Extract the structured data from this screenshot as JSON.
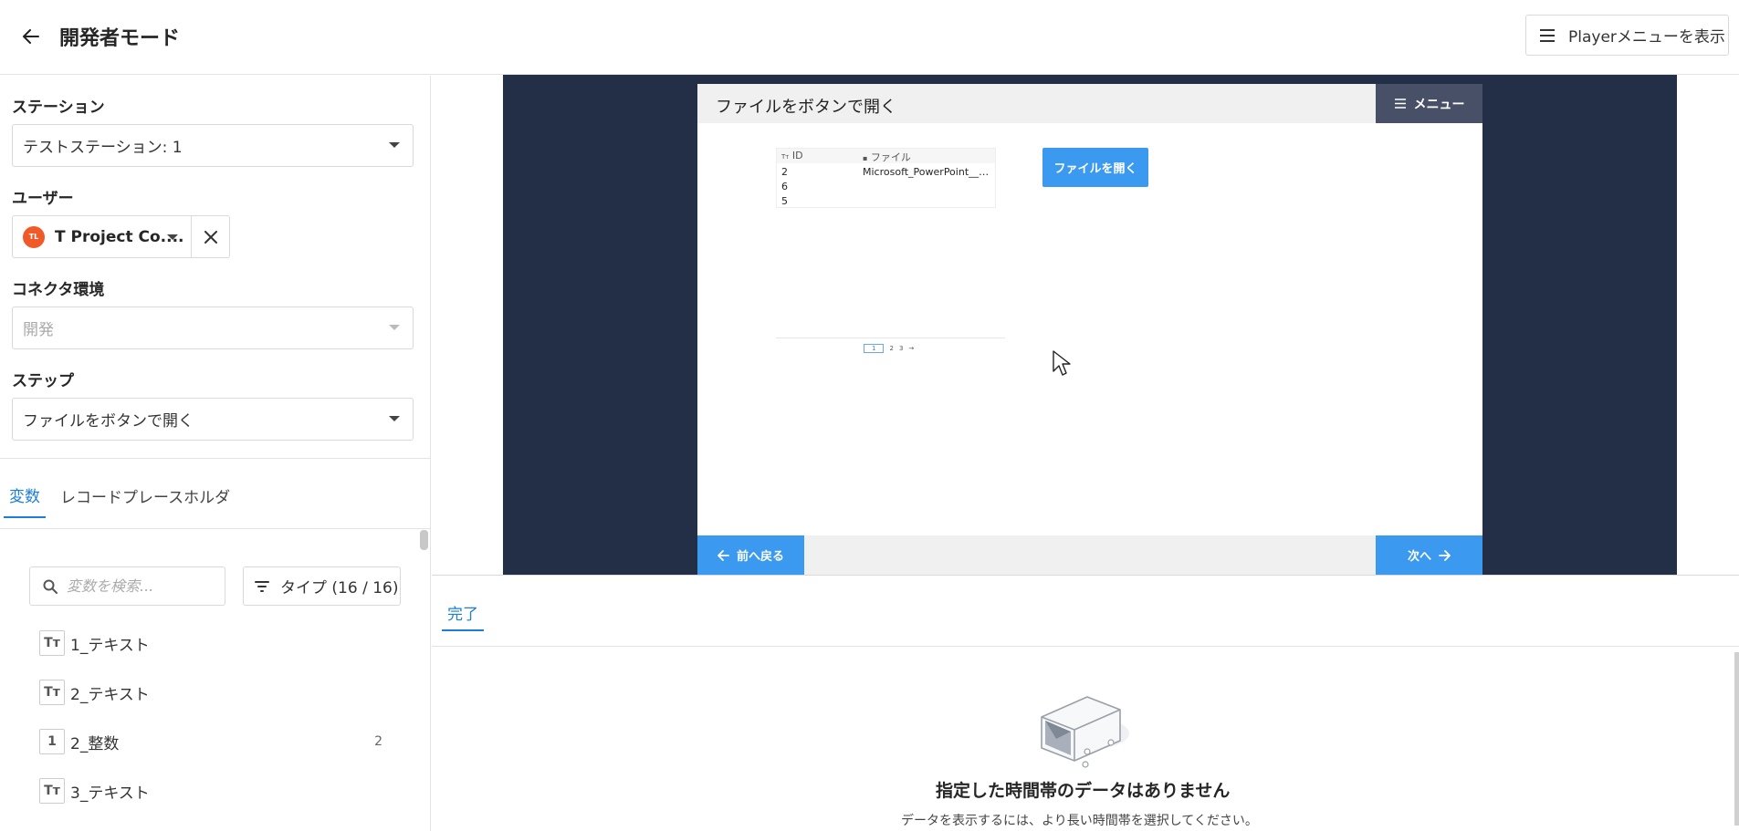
{
  "header": {
    "title": "開発者モード",
    "player_menu_label": "Playerメニューを表示"
  },
  "left_panel": {
    "station": {
      "label": "ステーション",
      "value": "テストステーション: 1"
    },
    "user": {
      "label": "ユーザー",
      "avatar_initials": "TL",
      "value": "T Project Co...."
    },
    "connector": {
      "label": "コネクタ環境",
      "value": "開発"
    },
    "step": {
      "label": "ステップ",
      "value": "ファイルをボタンで開く"
    },
    "tabs": [
      {
        "label": "変数",
        "active": true
      },
      {
        "label": "レコードプレースホルダ",
        "active": false
      }
    ],
    "search": {
      "placeholder": "変数を検索..."
    },
    "type_filter_label": "タイプ (16 / 16)",
    "variables": [
      {
        "icon": "Tт",
        "name": "1_テキスト",
        "value": ""
      },
      {
        "icon": "Tт",
        "name": "2_テキスト",
        "value": ""
      },
      {
        "icon": "1",
        "name": "2_整数",
        "value": "2"
      },
      {
        "icon": "Tт",
        "name": "3_テキスト",
        "value": ""
      }
    ]
  },
  "preview": {
    "app_title": "ファイルをボタンで開く",
    "menu_label": "メニュー",
    "table": {
      "columns": [
        "ID",
        "ファイル"
      ],
      "rows": [
        [
          "2",
          "Microsoft_PowerPoint__…"
        ],
        [
          "6",
          ""
        ],
        [
          "5",
          ""
        ]
      ]
    },
    "open_file_button": "ファイルを開く",
    "pager": {
      "current": "1",
      "pages": [
        "2",
        "3",
        "→"
      ]
    },
    "prev_button": "前へ戻る",
    "next_button": "次へ"
  },
  "bottom_panel": {
    "tab_label": "完了",
    "empty_title": "指定した時間帯のデータはありません",
    "empty_subtitle": "データを表示するには、より長い時間帯を選択してください。"
  },
  "colors": {
    "accent": "#1c7ed6",
    "preview_background": "#232f46",
    "app_button": "#3b9af0",
    "app_menu": "#475066",
    "avatar": "#f05a28"
  }
}
